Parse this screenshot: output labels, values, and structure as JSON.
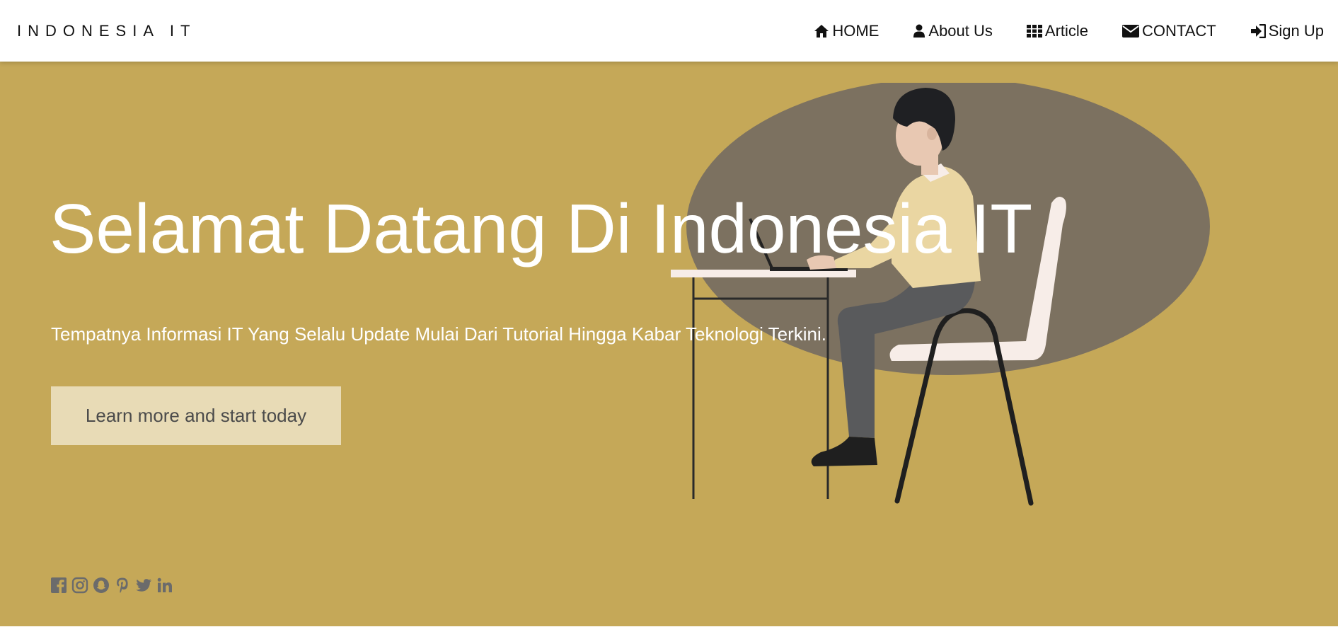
{
  "navbar": {
    "brand": "INDONESIA IT",
    "items": [
      {
        "label": "HOME",
        "icon": "home-icon"
      },
      {
        "label": "About Us",
        "icon": "user-icon"
      },
      {
        "label": "Article",
        "icon": "grid-icon"
      },
      {
        "label": "CONTACT",
        "icon": "envelope-icon"
      },
      {
        "label": "Sign Up",
        "icon": "sign-in-icon"
      }
    ]
  },
  "hero": {
    "title": "Selamat Datang Di Indonesia IT",
    "subtitle": "Tempatnya Informasi IT Yang Selalu Update Mulai Dari Tutorial Hingga Kabar Teknologi Terkini.",
    "cta_label": "Learn more and start today",
    "illustration": "person-working-on-laptop-illustration"
  },
  "social": [
    {
      "icon": "facebook-icon"
    },
    {
      "icon": "instagram-icon"
    },
    {
      "icon": "snapchat-icon"
    },
    {
      "icon": "pinterest-icon"
    },
    {
      "icon": "twitter-icon"
    },
    {
      "icon": "linkedin-icon"
    }
  ],
  "colors": {
    "hero_background": "#c5a858",
    "cta_background": "#e8dbb6",
    "navbar_background": "#ffffff",
    "social_icon": "#6b6b6b",
    "ellipse": "#7c7160"
  }
}
